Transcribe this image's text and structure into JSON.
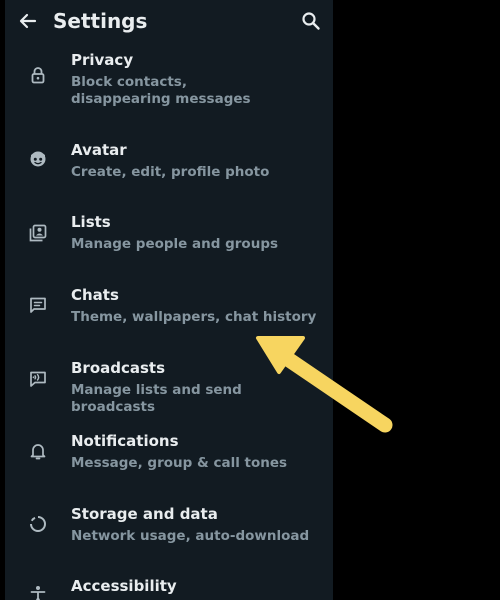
{
  "header": {
    "title": "Settings",
    "back_icon": "back-arrow-icon",
    "search_icon": "search-icon"
  },
  "settings": {
    "items": [
      {
        "label": "Privacy",
        "subtitle": "Block contacts, disappearing messages",
        "icon": "lock-icon"
      },
      {
        "label": "Avatar",
        "subtitle": "Create, edit, profile photo",
        "icon": "avatar-face-icon"
      },
      {
        "label": "Lists",
        "subtitle": "Manage people and groups",
        "icon": "lists-icon"
      },
      {
        "label": "Chats",
        "subtitle": "Theme, wallpapers, chat history",
        "icon": "chat-icon"
      },
      {
        "label": "Broadcasts",
        "subtitle": "Manage lists and send broadcasts",
        "icon": "broadcast-icon"
      },
      {
        "label": "Notifications",
        "subtitle": "Message, group & call tones",
        "icon": "bell-icon"
      },
      {
        "label": "Storage and data",
        "subtitle": "Network usage, auto-download",
        "icon": "storage-icon"
      },
      {
        "label": "Accessibility",
        "subtitle": "",
        "icon": "accessibility-icon"
      }
    ]
  },
  "colors": {
    "background": "#121b22",
    "outer_background": "#000000",
    "primary_text": "#e9edef",
    "secondary_text": "#8696a0",
    "icon": "#aebac1",
    "annotation_arrow": "#f7d560"
  }
}
